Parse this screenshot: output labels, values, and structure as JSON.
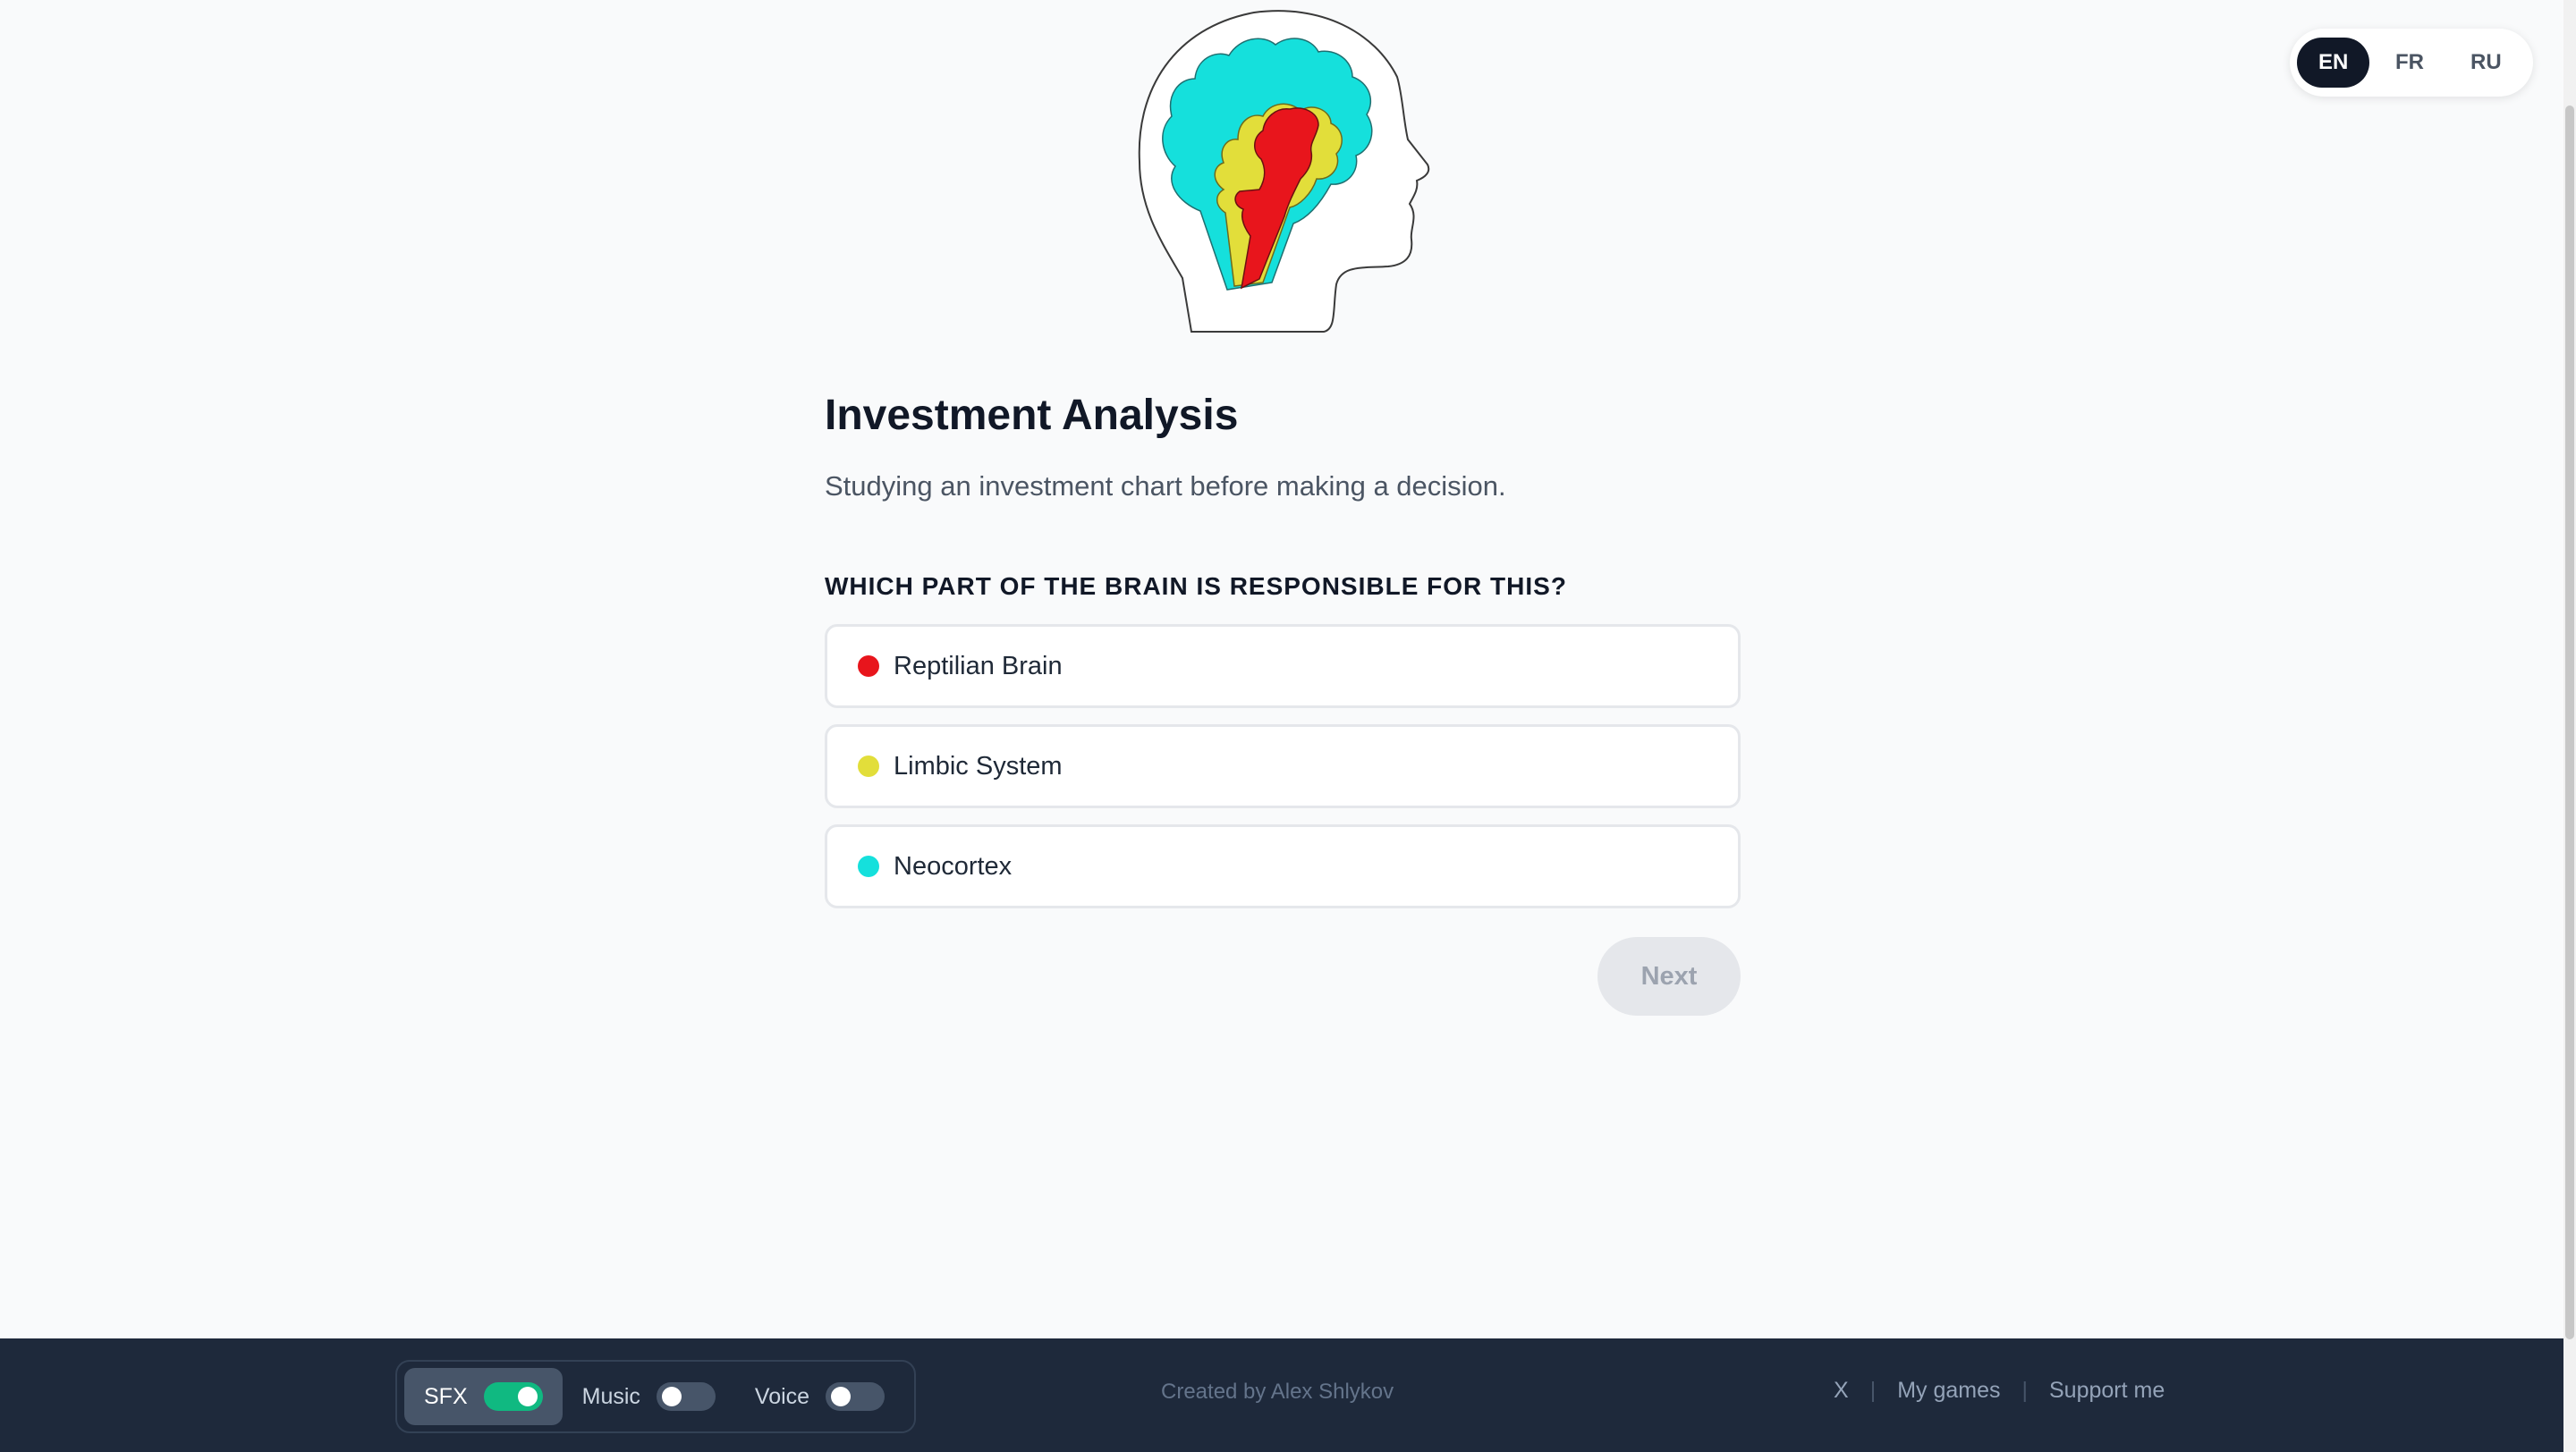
{
  "language_switch": {
    "options": [
      "EN",
      "FR",
      "RU"
    ],
    "selected": "EN"
  },
  "colors": {
    "reptilian": "#e8151c",
    "limbic": "#e2de3a",
    "neocortex": "#15e0dc",
    "accent_dark": "#111827",
    "footer_bg": "#1e293b",
    "toggle_on": "#10b981"
  },
  "scenario": {
    "title": "Investment Analysis",
    "description": "Studying an investment chart before making a decision."
  },
  "question": "WHICH PART OF THE BRAIN IS RESPONSIBLE FOR THIS?",
  "options": [
    {
      "label": "Reptilian Brain",
      "color": "#e8151c"
    },
    {
      "label": "Limbic System",
      "color": "#e2de3a"
    },
    {
      "label": "Neocortex",
      "color": "#15e0dc"
    }
  ],
  "next_button": {
    "label": "Next",
    "enabled": false
  },
  "footer": {
    "audio": [
      {
        "label": "SFX",
        "on": true
      },
      {
        "label": "Music",
        "on": false
      },
      {
        "label": "Voice",
        "on": false
      }
    ],
    "credit": "Created by Alex Shlykov",
    "links": [
      "X",
      "My games",
      "Support me"
    ],
    "separator": "|"
  }
}
